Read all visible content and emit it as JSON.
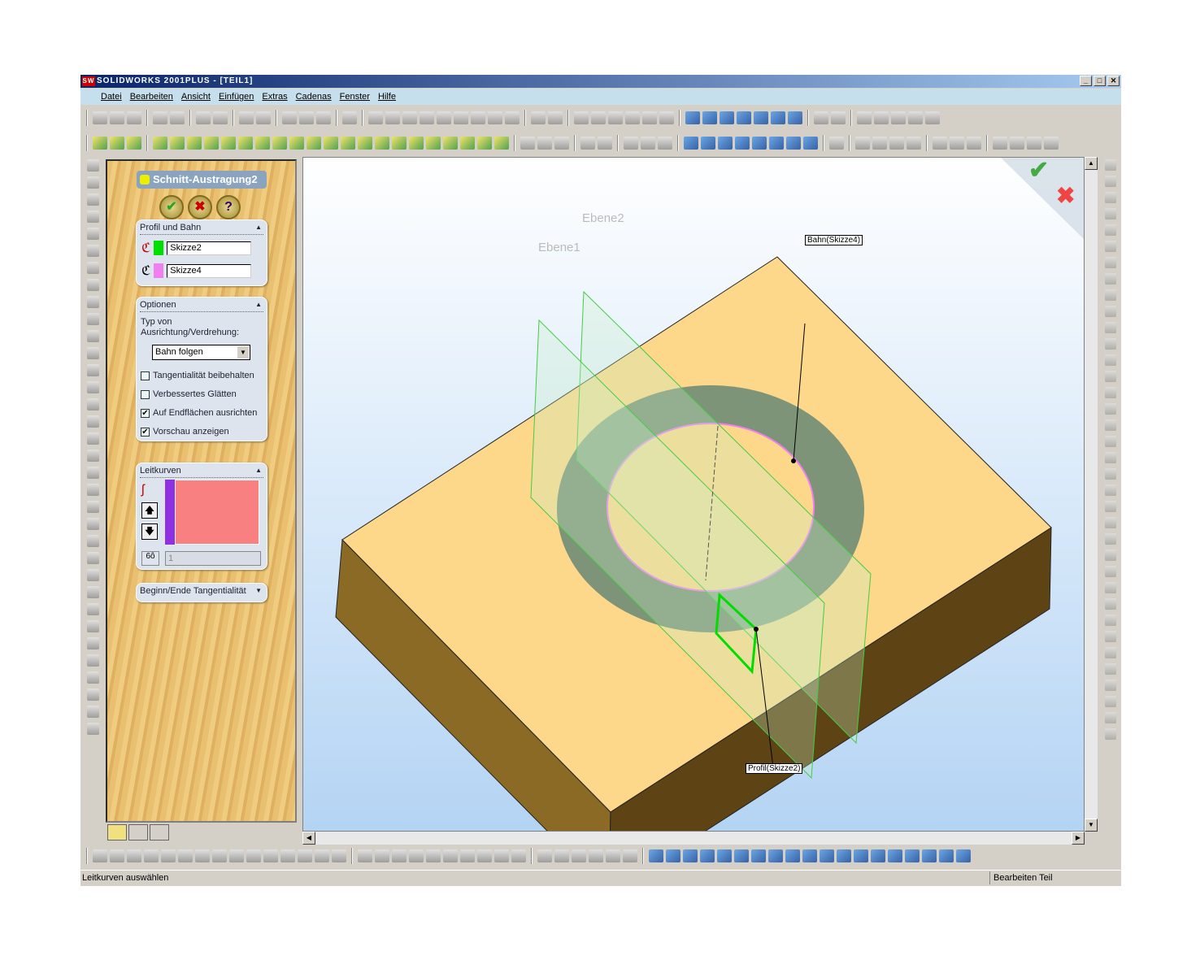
{
  "window": {
    "logo": "SW",
    "title": "SOLIDWORKS 2001PLUS - [TEIL1]",
    "min": "_",
    "max": "□",
    "close": "✕"
  },
  "menu": [
    "Datei",
    "Bearbeiten",
    "Ansicht",
    "Einfügen",
    "Extras",
    "Cadenas",
    "Fenster",
    "Hilfe"
  ],
  "pm": {
    "title": "Schnitt-Austragung2",
    "ok": "✔",
    "cancel": "✖",
    "help": "?",
    "profile_section": {
      "header": "Profil und Bahn",
      "profile": "Skizze2",
      "path": "Skizze4",
      "profile_color": "#00e000",
      "path_color": "#f080f0"
    },
    "options": {
      "header": "Optionen",
      "type_label": "Typ von Ausrichtung/Verdrehung:",
      "type_value": "Bahn folgen",
      "checks": [
        {
          "label": "Tangentialität beibehalten",
          "checked": false
        },
        {
          "label": "Verbessertes Glätten",
          "checked": false
        },
        {
          "label": "Auf Endflächen ausrichten",
          "checked": true
        },
        {
          "label": "Vorschau anzeigen",
          "checked": true
        }
      ]
    },
    "guides": {
      "header": "Leitkurven",
      "count": "1",
      "list_color": "#f88080"
    },
    "tangency": {
      "header": "Beginn/Ende Tangentialität"
    }
  },
  "viewport": {
    "plane1": "Ebene2",
    "plane2": "Ebene1",
    "path_label": "Bahn(Skizze4)",
    "profile_label": "Profil(Skizze2)",
    "confirm": "✔",
    "reject": "✖"
  },
  "status": {
    "message": "Leitkurven auswählen",
    "mode": "Bearbeiten Teil"
  },
  "colors": {
    "top_face": "#fdd78a",
    "left_face": "#8a6a24",
    "right_face": "#5e4414",
    "ring": "#7e9478"
  }
}
